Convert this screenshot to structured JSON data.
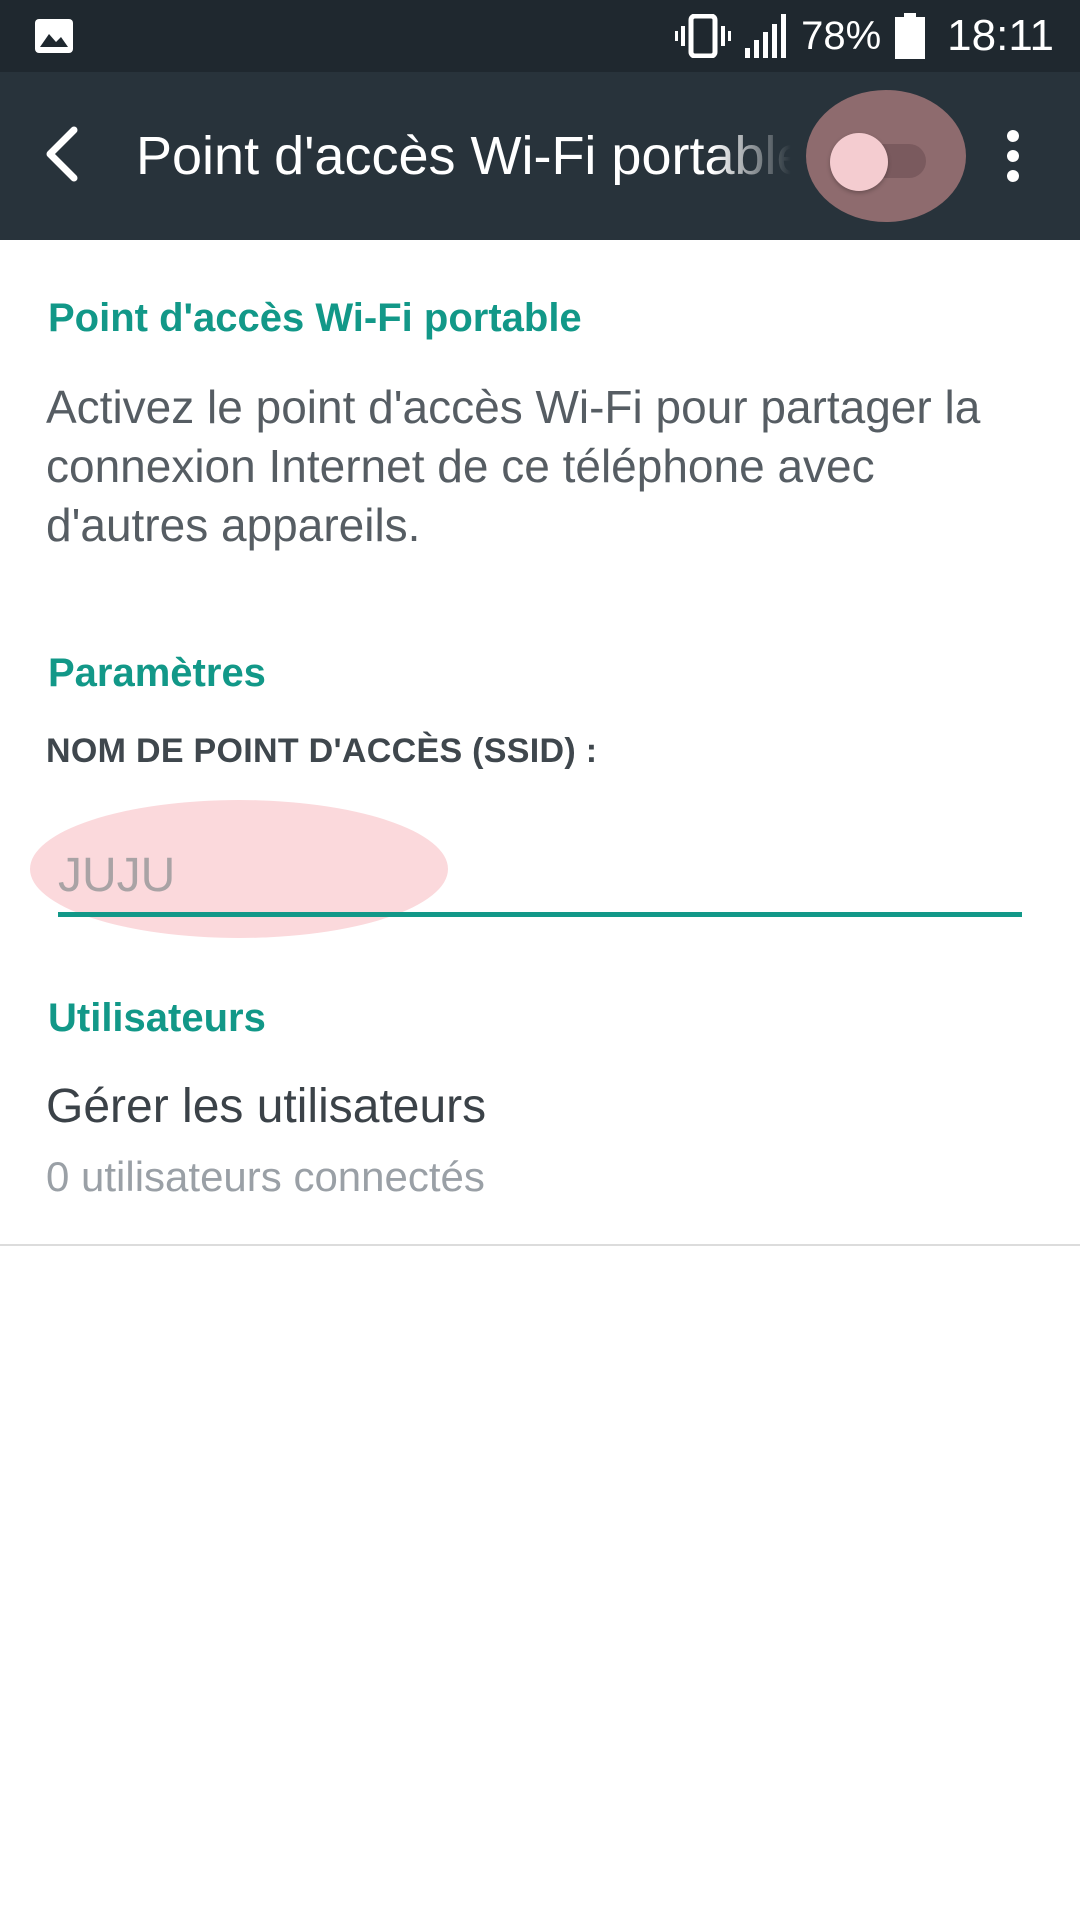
{
  "status_bar": {
    "left_icon": "image-icon",
    "icons": [
      "vibrate-icon",
      "signal-icon",
      "battery-icon"
    ],
    "battery_percent": "78%",
    "time": "18:11"
  },
  "toolbar": {
    "back_icon": "arrow-left-icon",
    "title": "Point d'accès Wi-Fi portable",
    "toggle_on": false,
    "overflow_icon": "more-vertical-icon"
  },
  "hotspot_section": {
    "header": "Point d'accès Wi-Fi portable",
    "description": "Activez le point d'accès Wi-Fi pour partager la connexion Internet de ce téléphone avec d'autres appareils."
  },
  "settings_section": {
    "header": "Paramètres",
    "ssid_label": "NOM DE POINT D'ACCÈS (SSID) :",
    "ssid_value": "JUJU"
  },
  "users_section": {
    "header": "Utilisateurs",
    "manage_title": "Gérer les utilisateurs",
    "manage_subtitle": "0 utilisateurs connectés"
  },
  "colors": {
    "accent": "#129888",
    "status_bar_bg": "#1f282f",
    "toolbar_bg": "#28333b",
    "highlight": "#fbd9dc"
  }
}
